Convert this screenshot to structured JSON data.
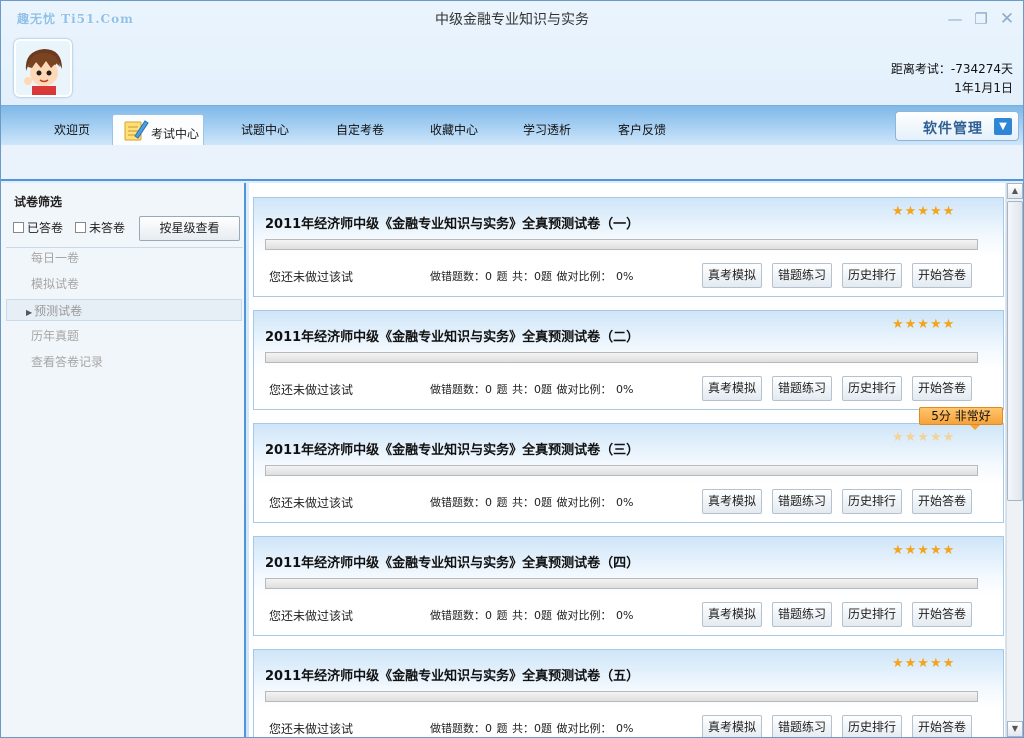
{
  "window": {
    "brand": "趣无忧 Ti51.Com",
    "title": "中级金融专业知识与实务"
  },
  "header": {
    "countdown": "距离考试：-734274天",
    "date": "1年1月1日"
  },
  "nav": {
    "tabs": [
      "欢迎页",
      "考试中心",
      "试题中心",
      "自定考卷",
      "收藏中心",
      "学习透析",
      "客户反馈"
    ],
    "active": "考试中心",
    "software_button": "软件管理"
  },
  "sidebar": {
    "title": "试卷筛选",
    "filter_done": "已答卷",
    "filter_undone": "未答卷",
    "star_button": "按星级查看",
    "items": [
      "每日一卷",
      "模拟试卷",
      "预测试卷",
      "历年真题",
      "查看答卷记录"
    ],
    "selected": "预测试卷"
  },
  "papers": [
    {
      "title": "2011年经济师中级《金融专业知识与实务》全真预测试卷（一）",
      "stars": "★★★★★",
      "status": "您还未做过该试",
      "stats": "做错题数：0 题  共：0题   做对比例： 0%",
      "progress": 0
    },
    {
      "title": "2011年经济师中级《金融专业知识与实务》全真预测试卷（二）",
      "stars": "★★★★★",
      "status": "您还未做过该试",
      "stats": "做错题数：0 题  共：0题   做对比例： 0%",
      "progress": 0
    },
    {
      "title": "2011年经济师中级《金融专业知识与实务》全真预测试卷（三）",
      "stars": "★★★★★",
      "status": "您还未做过该试",
      "stats": "做错题数：0 题  共：0题   做对比例： 0%",
      "progress": 0
    },
    {
      "title": "2011年经济师中级《金融专业知识与实务》全真预测试卷（四）",
      "stars": "★★★★★",
      "status": "您还未做过该试",
      "stats": "做错题数：0 题  共：0题   做对比例： 0%",
      "progress": 0
    },
    {
      "title": "2011年经济师中级《金融专业知识与实务》全真预测试卷（五）",
      "stars": "★★★★★",
      "status": "您还未做过该试",
      "stats": "做错题数：0 题  共：0题   做对比例： 0%",
      "progress": 0
    }
  ],
  "paper_buttons": [
    "真考模拟",
    "错题练习",
    "历史排行",
    "开始答卷"
  ],
  "tooltip": "5分  非常好",
  "colors": {
    "accent": "#4f95d9",
    "star": "#f3a419",
    "tooltip": "#f6a23a"
  }
}
